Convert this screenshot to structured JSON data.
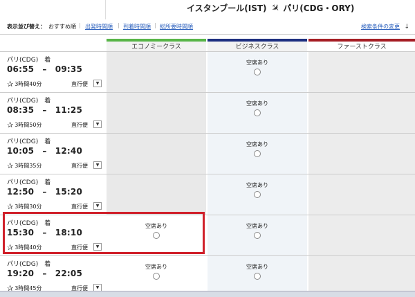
{
  "route": {
    "origin": "イスタンブール(IST)",
    "destination": "パリ(CDG・ORY)"
  },
  "sort": {
    "label": "表示並び替え：",
    "current": "おすすめ順",
    "options": [
      "出発時間順",
      "到着時間順",
      "総所要時間順"
    ],
    "change_link": "検索条件の変更"
  },
  "columns": {
    "economy": "エコノミークラス",
    "business": "ビジネスクラス",
    "first": "ファーストクラス"
  },
  "rows": [
    {
      "arrival": "パリ(CDG)　着",
      "times": "06:55　–　09:35",
      "duration": "3時間40分",
      "direct": "直行便",
      "economy": "",
      "business": "空席あり",
      "first": ""
    },
    {
      "arrival": "パリ(CDG)　着",
      "times": "08:35　–　11:25",
      "duration": "3時間50分",
      "direct": "直行便",
      "economy": "",
      "business": "空席あり",
      "first": ""
    },
    {
      "arrival": "パリ(CDG)　着",
      "times": "10:05　–　12:40",
      "duration": "3時間35分",
      "direct": "直行便",
      "economy": "",
      "business": "空席あり",
      "first": ""
    },
    {
      "arrival": "パリ(CDG)　着",
      "times": "12:50　–　15:20",
      "duration": "3時間30分",
      "direct": "直行便",
      "economy": "",
      "business": "空席あり",
      "first": ""
    },
    {
      "arrival": "パリ(CDG)　着",
      "times": "15:30　–　18:10",
      "duration": "3時間40分",
      "direct": "直行便",
      "economy": "空席あり",
      "business": "空席あり",
      "first": ""
    },
    {
      "arrival": "パリ(CDG)　着",
      "times": "19:20　–　22:05",
      "duration": "3時間45分",
      "direct": "直行便",
      "economy": "空席あり",
      "business": "空席あり",
      "first": ""
    }
  ],
  "colors": {
    "economy": "#58b548",
    "business": "#1d2f80",
    "first": "#a51d24",
    "highlight": "#d0202a",
    "link": "#2a5fbd"
  }
}
